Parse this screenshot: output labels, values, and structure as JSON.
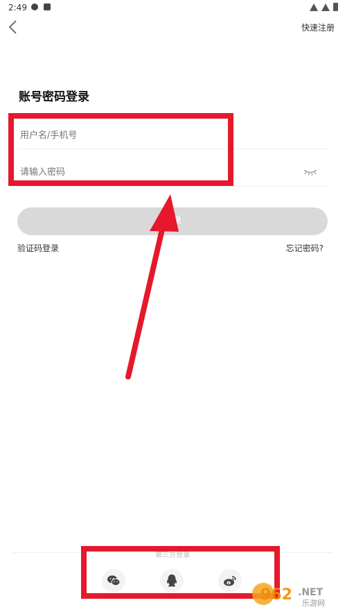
{
  "status_bar": {
    "time": "2:49"
  },
  "header": {
    "register_label": "快速注册"
  },
  "form": {
    "title": "账号密码登录",
    "username_placeholder": "用户名/手机号",
    "password_placeholder": "请输入密码",
    "login_label": "登录",
    "sms_login_label": "验证码登录",
    "forgot_label": "忘记密码?"
  },
  "third_party": {
    "label": "第三方登录",
    "icons": [
      "wechat-icon",
      "qq-icon",
      "weibo-icon"
    ]
  },
  "watermark": {
    "text": "962.NET",
    "sub": "乐游网"
  },
  "colors": {
    "annotation": "#e5182c",
    "button_bg": "#d9d9d9"
  }
}
